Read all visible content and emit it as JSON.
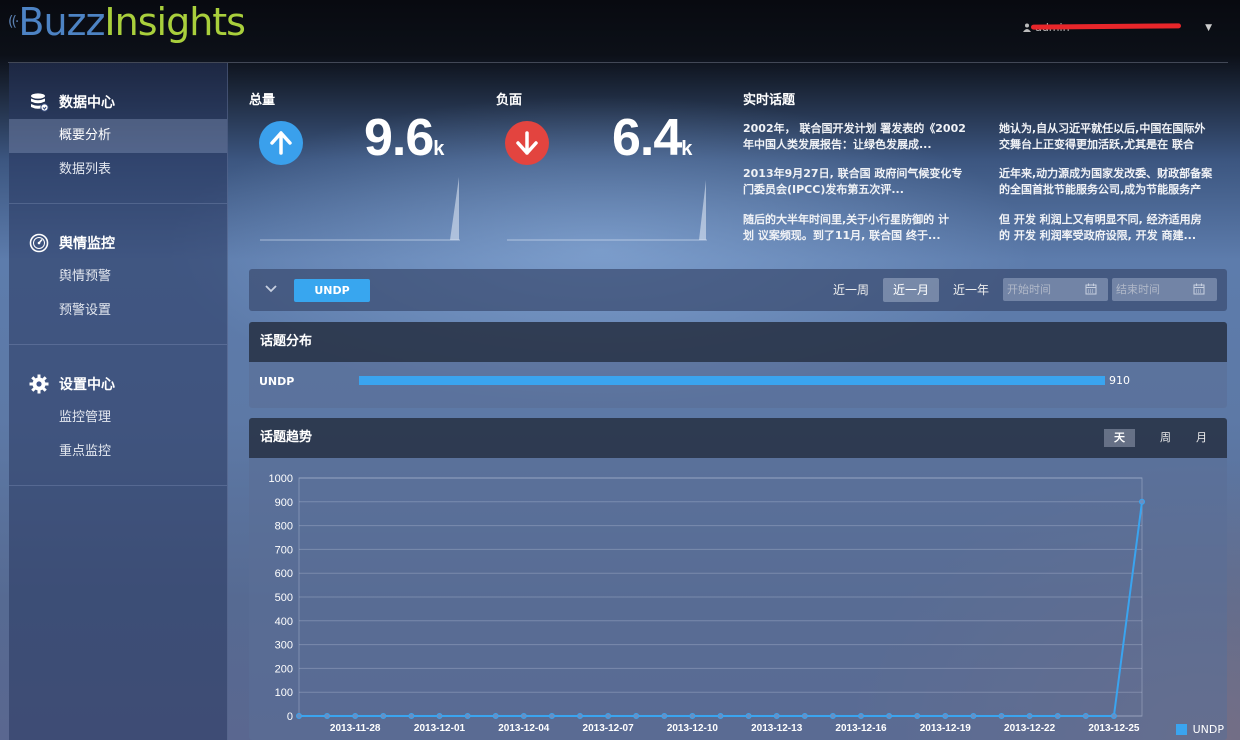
{
  "header": {
    "logo_part1": "Buzz",
    "logo_part2": "Insights",
    "user_name": "admin"
  },
  "sidebar": {
    "groups": [
      {
        "title": "数据中心",
        "icon": "database-icon",
        "items": [
          {
            "label": "概要分析",
            "active": true
          },
          {
            "label": "数据列表",
            "active": false
          }
        ]
      },
      {
        "title": "舆情监控",
        "icon": "gauge-icon",
        "items": [
          {
            "label": "舆情预警",
            "active": false
          },
          {
            "label": "预警设置",
            "active": false
          }
        ]
      },
      {
        "title": "设置中心",
        "icon": "gear-icon",
        "items": [
          {
            "label": "监控管理",
            "active": false
          },
          {
            "label": "重点监控",
            "active": false
          }
        ]
      }
    ]
  },
  "stats": {
    "total": {
      "title": "总量",
      "value": "9.6",
      "unit": "k",
      "icon": "arrow-up-icon",
      "color": "#3aa0ec"
    },
    "negative": {
      "title": "负面",
      "value": "6.4",
      "unit": "k",
      "icon": "arrow-down-icon",
      "color": "#e3443f"
    }
  },
  "news": {
    "title": "实时话题",
    "items": [
      {
        "line1": "2002年， 联合国开发计划 署发表的《2002",
        "line2": "年中国人类发展报告：让绿色发展成..."
      },
      {
        "line1": "她认为,自从习近平就任以后,中国在国际外",
        "line2": "交舞台上正变得更加活跃,尤其是在 联合"
      },
      {
        "line1": "2013年9月27日, 联合国 政府间气候变化专",
        "line2": "门委员会(IPCC)发布第五次评..."
      },
      {
        "line1": "近年来,动力源成为国家发改委、财政部备案",
        "line2": "的全国首批节能服务公司,成为节能服务产"
      },
      {
        "line1": "随后的大半年时间里,关于小行星防御的 计",
        "line2": "划 议案频现。到了11月, 联合国 终于..."
      },
      {
        "line1": "但 开发 利润上又有明显不同, 经济适用房",
        "line2": "的 开发 利润率受政府设限, 开发 商建..."
      }
    ]
  },
  "filter": {
    "tag": "UNDP",
    "ranges": [
      {
        "label": "近一周",
        "active": false
      },
      {
        "label": "近一月",
        "active": true
      },
      {
        "label": "近一年",
        "active": false
      }
    ],
    "start_placeholder": "开始时间",
    "end_placeholder": "结束时间"
  },
  "distribution": {
    "title": "话题分布",
    "rows": [
      {
        "label": "UNDP",
        "value": 910,
        "value_label": "910",
        "fraction": 1.0
      }
    ]
  },
  "trend": {
    "title": "话题趋势",
    "granularity": [
      {
        "label": "天",
        "active": true
      },
      {
        "label": "周",
        "active": false
      },
      {
        "label": "月",
        "active": false
      }
    ]
  },
  "chart_data": {
    "type": "line",
    "title": "",
    "xlabel": "",
    "ylabel": "",
    "ylim": [
      0,
      1000
    ],
    "yticks": [
      0,
      100,
      200,
      300,
      400,
      500,
      600,
      700,
      800,
      900,
      1000
    ],
    "grid": true,
    "legend": "bottom-right",
    "x": [
      "2013-11-26",
      "2013-11-27",
      "2013-11-28",
      "2013-11-29",
      "2013-11-30",
      "2013-12-01",
      "2013-12-02",
      "2013-12-03",
      "2013-12-04",
      "2013-12-05",
      "2013-12-06",
      "2013-12-07",
      "2013-12-08",
      "2013-12-09",
      "2013-12-10",
      "2013-12-11",
      "2013-12-12",
      "2013-12-13",
      "2013-12-14",
      "2013-12-15",
      "2013-12-16",
      "2013-12-17",
      "2013-12-18",
      "2013-12-19",
      "2013-12-20",
      "2013-12-21",
      "2013-12-22",
      "2013-12-23",
      "2013-12-24",
      "2013-12-25",
      "2013-12-26"
    ],
    "xtick_labels": [
      "2013-11-28",
      "2013-12-01",
      "2013-12-04",
      "2013-12-07",
      "2013-12-10",
      "2013-12-13",
      "2013-12-16",
      "2013-12-19",
      "2013-12-22",
      "2013-12-25"
    ],
    "series": [
      {
        "name": "UNDP",
        "color": "#3aa4ef",
        "values": [
          0,
          0,
          0,
          0,
          0,
          0,
          0,
          0,
          0,
          0,
          0,
          0,
          0,
          0,
          0,
          0,
          0,
          0,
          0,
          0,
          0,
          0,
          0,
          0,
          0,
          0,
          0,
          0,
          0,
          0,
          900
        ]
      }
    ]
  }
}
